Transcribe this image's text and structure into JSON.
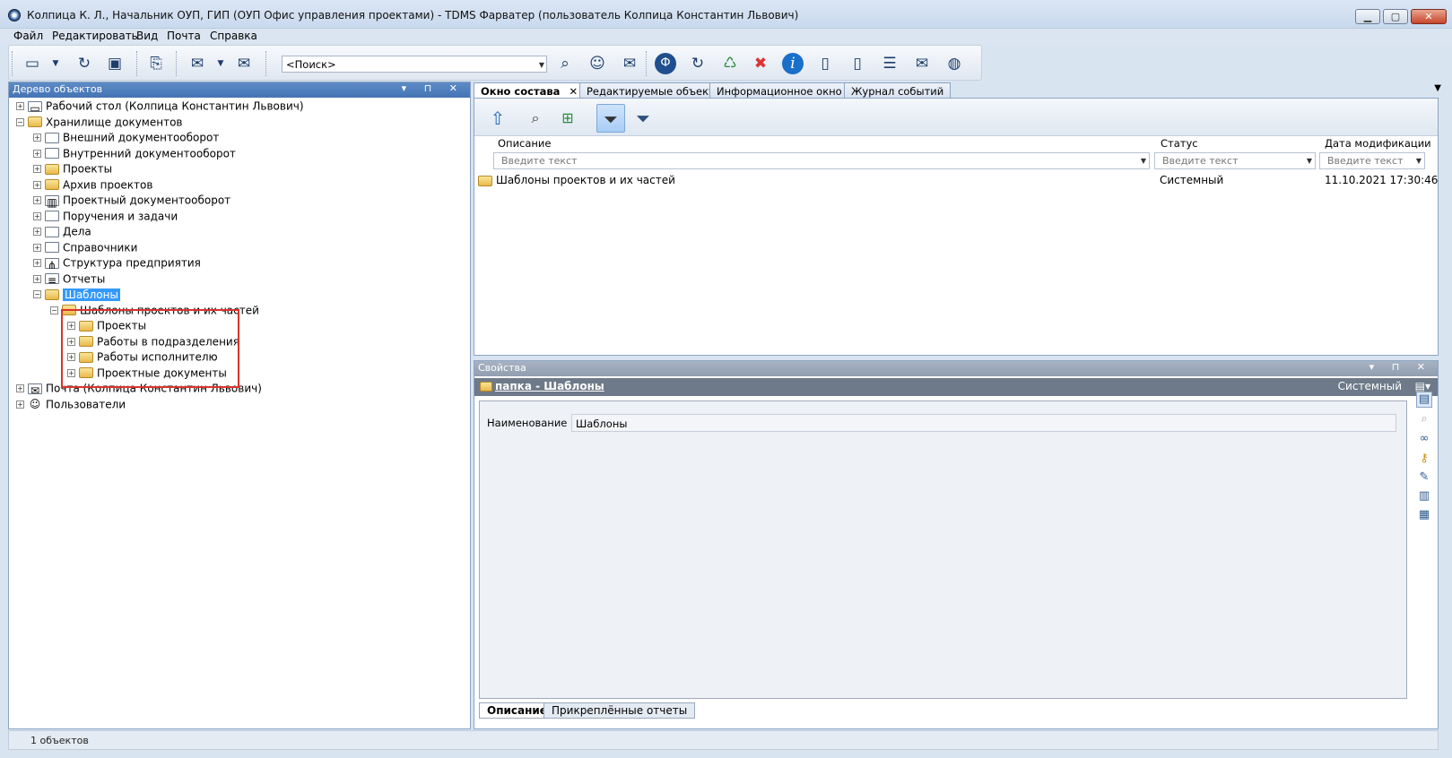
{
  "window": {
    "title": "Колпица К. Л., Начальник ОУП, ГИП (ОУП Офис управления проектами) - TDMS Фарватер (пользователь Колпица Константин Львович)",
    "minimize": "▁",
    "maximize": "▢",
    "close": "✕"
  },
  "menu": [
    "Файл",
    "Редактировать",
    "Вид",
    "Почта",
    "Справка"
  ],
  "toolbar": {
    "search_placeholder": "<Поиск>"
  },
  "left_pane": {
    "title": "Дерево объектов",
    "controls": "▾ ⊓ ✕",
    "tree": [
      {
        "label": "Рабочий стол (Колпица Константин Львович)",
        "level": 0,
        "exp": "+",
        "icon": "desktop-icon"
      },
      {
        "label": "Хранилище документов",
        "level": 0,
        "exp": "−",
        "icon": "storage-icon"
      },
      {
        "label": "Внешний документооборот",
        "level": 1,
        "exp": "+",
        "icon": "folder-icon"
      },
      {
        "label": "Внутренний документооборот",
        "level": 1,
        "exp": "+",
        "icon": "folder-icon"
      },
      {
        "label": "Проекты",
        "level": 1,
        "exp": "+",
        "icon": "projects-icon"
      },
      {
        "label": "Архив проектов",
        "level": 1,
        "exp": "+",
        "icon": "archive-icon"
      },
      {
        "label": "Проектный документооборот",
        "level": 1,
        "exp": "+",
        "icon": "books-icon"
      },
      {
        "label": "Поручения и задачи",
        "level": 1,
        "exp": "+",
        "icon": "folder-icon"
      },
      {
        "label": "Дела",
        "level": 1,
        "exp": "+",
        "icon": "folder-icon"
      },
      {
        "label": "Справочники",
        "level": 1,
        "exp": "+",
        "icon": "folder-icon"
      },
      {
        "label": "Структура предприятия",
        "level": 1,
        "exp": "+",
        "icon": "structure-icon"
      },
      {
        "label": "Отчеты",
        "level": 1,
        "exp": "+",
        "icon": "reports-icon"
      },
      {
        "label": "Шаблоны",
        "level": 1,
        "exp": "−",
        "icon": "templates-folder-icon",
        "selected": true
      },
      {
        "label": "Шаблоны проектов и их частей",
        "level": 2,
        "exp": "−",
        "icon": "templates-folder-icon"
      },
      {
        "label": "Проекты",
        "level": 3,
        "exp": "+",
        "icon": "templates-folder-icon"
      },
      {
        "label": "Работы в подразделения",
        "level": 3,
        "exp": "+",
        "icon": "templates-folder-icon"
      },
      {
        "label": "Работы исполнителю",
        "level": 3,
        "exp": "+",
        "icon": "templates-folder-icon"
      },
      {
        "label": "Проектные документы",
        "level": 3,
        "exp": "+",
        "icon": "templates-folder-icon"
      },
      {
        "label": "Почта (Колпица Константин Львович)",
        "level": 0,
        "exp": "+",
        "icon": "mail-icon"
      },
      {
        "label": "Пользователи",
        "level": 0,
        "exp": "+",
        "icon": "user-icon"
      }
    ]
  },
  "tabs": [
    {
      "label": "Окно состава",
      "active": true,
      "close": "✕"
    },
    {
      "label": "Редактируемые объекты"
    },
    {
      "label": "Информационное окно"
    },
    {
      "label": "Журнал событий"
    }
  ],
  "tabs_overflow": "▼",
  "composition": {
    "columns": [
      "Описание",
      "Статус",
      "Дата модификации"
    ],
    "filter_placeholder": "Введите текст",
    "rows": [
      {
        "description": "Шаблоны проектов и их частей",
        "status": "Системный",
        "modified": "11.10.2021 17:30:46"
      }
    ]
  },
  "properties": {
    "title": "Свойства",
    "controls": "▾ ⊓ ✕",
    "object_link": "папка - Шаблоны",
    "object_status": "Системный",
    "field_label": "Наименование",
    "field_value": "Шаблоны",
    "tabs": [
      "Описание",
      "Прикреплённые отчеты"
    ]
  },
  "status": {
    "text": "1 объектов"
  }
}
